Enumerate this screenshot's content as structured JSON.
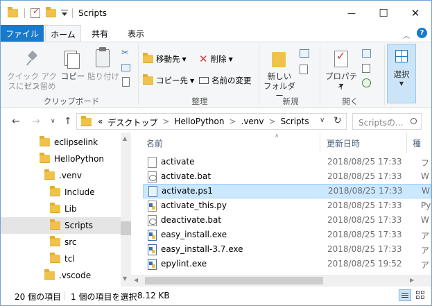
{
  "window": {
    "title": "Scripts",
    "accent": "#1979ca",
    "minimize_glyph": "—",
    "maximize_glyph": "☐",
    "close_glyph": "✕"
  },
  "ribbon_tabs": [
    {
      "label": "ファイル",
      "active": false,
      "file": true
    },
    {
      "label": "ホーム",
      "active": true
    },
    {
      "label": "共有",
      "active": false
    },
    {
      "label": "表示",
      "active": false
    }
  ],
  "ribbon": {
    "quick_access": "クイック アクセス",
    "pin": "スにピン留め",
    "copy": "コピー",
    "paste": "貼り付け",
    "clipboard_group": "クリップボード",
    "move_to": "移動先",
    "copy_to": "コピー先",
    "delete": "削除",
    "rename": "名前の変更",
    "organize_group": "整理",
    "new_folder_1": "新しい",
    "new_folder_2": "フォルダー",
    "new_group": "新規",
    "properties": "プロパティ",
    "open_group": "開く",
    "select": "選択"
  },
  "address": {
    "overflow": "«",
    "crumbs": [
      "デスクトップ",
      "HelloPython",
      ".venv",
      "Scripts"
    ],
    "sep": ">",
    "search_placeholder": "Scriptsの..."
  },
  "tree": [
    {
      "label": "eclipselink",
      "selected": false
    },
    {
      "label": "HelloPython",
      "selected": false
    },
    {
      "label": ".venv",
      "selected": false
    },
    {
      "label": "Include",
      "selected": false
    },
    {
      "label": "Lib",
      "selected": false
    },
    {
      "label": "Scripts",
      "selected": true
    },
    {
      "label": "src",
      "selected": false
    },
    {
      "label": "tcl",
      "selected": false
    },
    {
      "label": ".vscode",
      "selected": false
    }
  ],
  "columns": {
    "name": "名前",
    "date": "更新日時",
    "type": "種"
  },
  "files": [
    {
      "name": "activate",
      "date": "2018/08/25 17:33",
      "type": "フ",
      "icon": "blank",
      "selected": false
    },
    {
      "name": "activate.bat",
      "date": "2018/08/25 17:33",
      "type": "W",
      "icon": "bat",
      "selected": false
    },
    {
      "name": "activate.ps1",
      "date": "2018/08/25 17:33",
      "type": "W",
      "icon": "ps1",
      "selected": true
    },
    {
      "name": "activate_this.py",
      "date": "2018/08/25 17:33",
      "type": "Py",
      "icon": "py",
      "selected": false
    },
    {
      "name": "deactivate.bat",
      "date": "2018/08/25 17:33",
      "type": "W",
      "icon": "bat",
      "selected": false
    },
    {
      "name": "easy_install.exe",
      "date": "2018/08/25 17:33",
      "type": "ア",
      "icon": "exe",
      "selected": false
    },
    {
      "name": "easy_install-3.7.exe",
      "date": "2018/08/25 17:33",
      "type": "ア",
      "icon": "exe",
      "selected": false
    },
    {
      "name": "epylint.exe",
      "date": "2018/08/25 19:52",
      "type": "ア",
      "icon": "exe",
      "selected": false
    }
  ],
  "status": {
    "count": "20 個の項目",
    "selection": "1 個の項目を選択",
    "size": "8.12 KB"
  }
}
